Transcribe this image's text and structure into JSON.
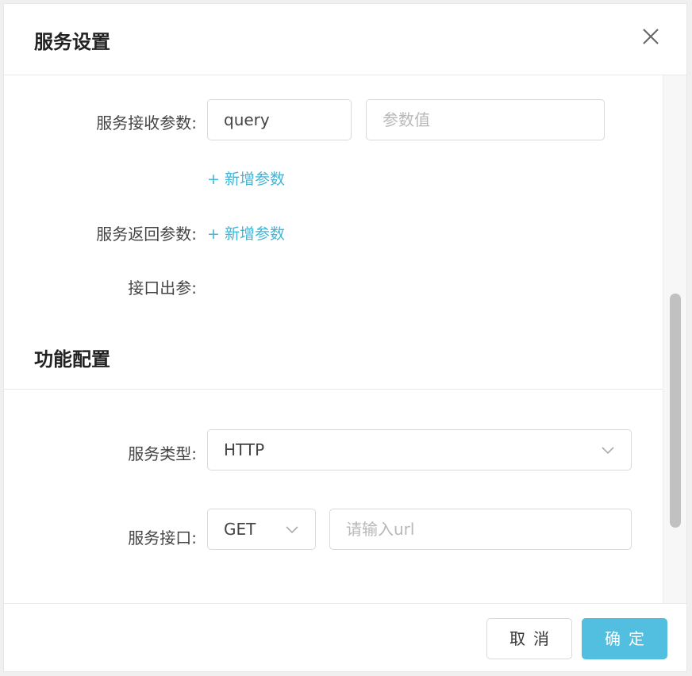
{
  "dialog": {
    "title": "服务设置",
    "close_icon": "close-icon"
  },
  "service_receive": {
    "label": "服务接收参数:",
    "param_name_value": "query",
    "param_value_placeholder": "参数值",
    "add_link": "+ 新增参数"
  },
  "service_return": {
    "label": "服务返回参数:",
    "add_link": "+ 新增参数"
  },
  "interface_out": {
    "label": "接口出参:"
  },
  "function_config": {
    "section_title": "功能配置",
    "service_type": {
      "label": "服务类型:",
      "value": "HTTP"
    },
    "service_interface": {
      "label": "服务接口:",
      "method_value": "GET",
      "url_placeholder": "请输入url"
    }
  },
  "footer": {
    "cancel_label": "取消",
    "ok_label": "确定"
  },
  "colors": {
    "accent": "#52bee0",
    "link": "#42b4d6"
  }
}
